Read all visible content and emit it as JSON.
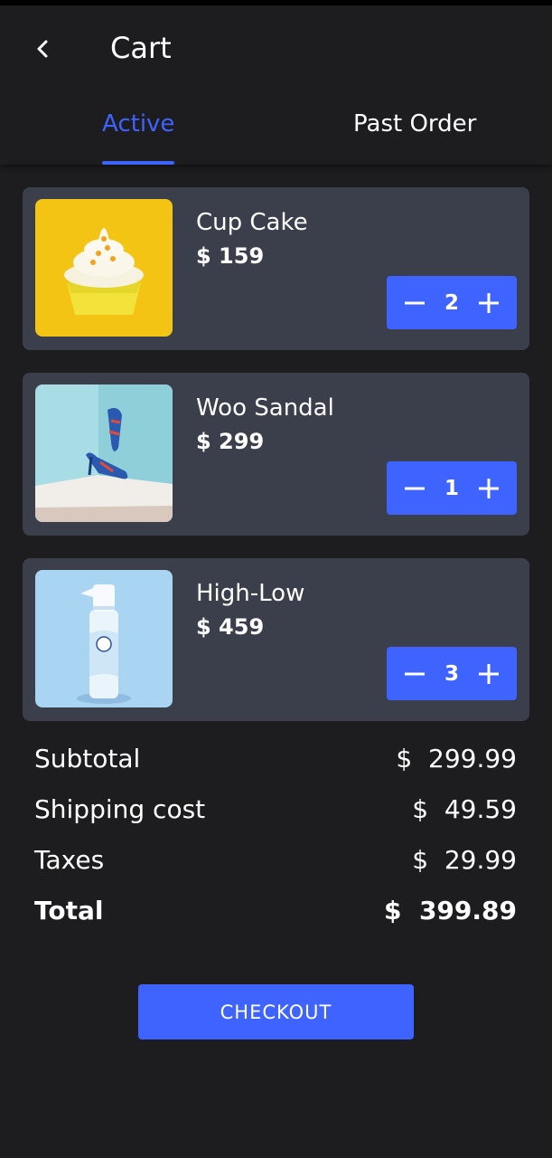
{
  "header": {
    "title": "Cart"
  },
  "tabs": [
    {
      "label": "Active",
      "active": true
    },
    {
      "label": "Past Order",
      "active": false
    }
  ],
  "items": [
    {
      "name": "Cup Cake",
      "price": "$ 159",
      "quantity": "2",
      "image": "cupcake"
    },
    {
      "name": "Woo Sandal",
      "price": "$ 299",
      "quantity": "1",
      "image": "sandal"
    },
    {
      "name": "High-Low",
      "price": "$ 459",
      "quantity": "3",
      "image": "spray"
    }
  ],
  "summary": {
    "subtotal_label": "Subtotal",
    "subtotal_value": "$  299.99",
    "shipping_label": "Shipping cost",
    "shipping_value": "$  49.59",
    "taxes_label": "Taxes",
    "taxes_value": "$  29.99",
    "total_label": "Total",
    "total_value": "$  399.89"
  },
  "checkout_label": "CHECKOUT",
  "colors": {
    "accent": "#3e63ff",
    "background": "#1d1d1f",
    "card": "#3b3f4b"
  }
}
